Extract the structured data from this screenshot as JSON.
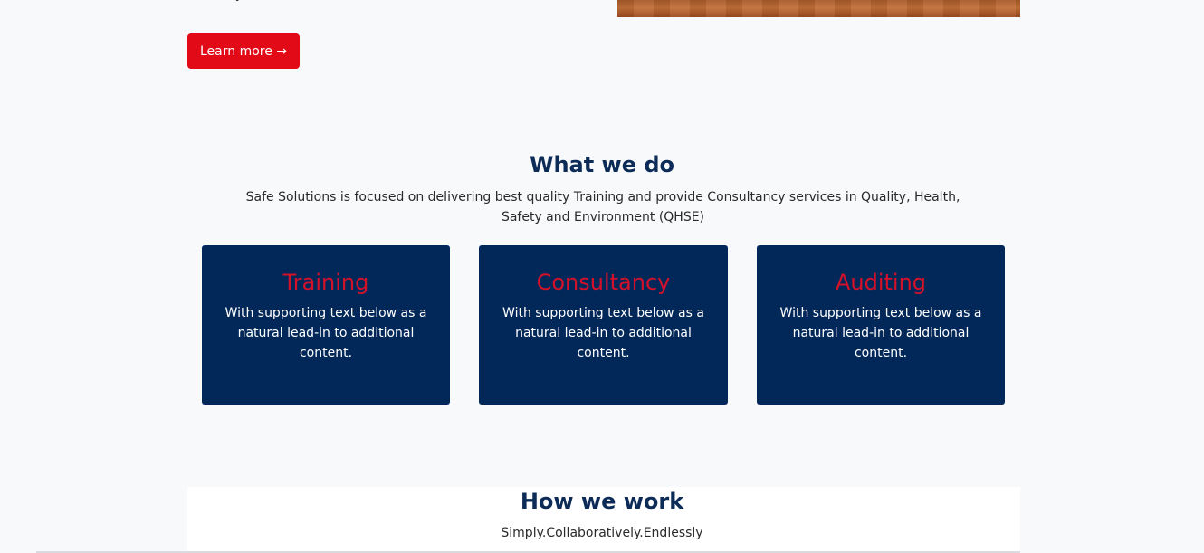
{
  "hero": {
    "text_fragment": "y",
    "learn_more_label": "Learn more →"
  },
  "what_we_do": {
    "title": "What we do",
    "description": "Safe Solutions is focused on delivering best quality Training and provide Consultancy services in Quality, Health, Safety and Environment (QHSE)",
    "cards": [
      {
        "title": "Training",
        "text": "With supporting text below as a natural lead-in to additional content."
      },
      {
        "title": "Consultancy",
        "text": "With supporting text below as a natural lead-in to additional content."
      },
      {
        "title": "Auditing",
        "text": "With supporting text below as a natural lead-in to additional content."
      }
    ]
  },
  "how_we_work": {
    "title": "How we work",
    "subtitle": "Simply.Collaboratively.Endlessly"
  },
  "colors": {
    "accent_red": "#e20a17",
    "navy": "#02285a",
    "heading_navy": "#0c2b56",
    "card_title_red": "#d3122a",
    "page_background": "#f8f9fb"
  }
}
